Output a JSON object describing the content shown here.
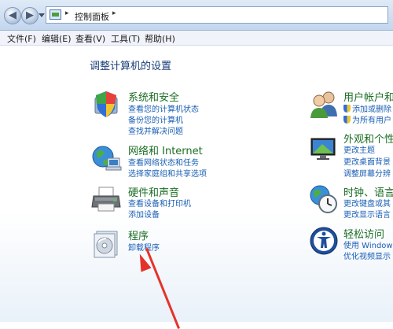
{
  "address": {
    "breadcrumb": "控制面板",
    "separator": "▸"
  },
  "menu": {
    "items": [
      "文件(F)",
      "编辑(E)",
      "查看(V)",
      "工具(T)",
      "帮助(H)"
    ]
  },
  "main": {
    "title": "调整计算机的设置",
    "left_categories": [
      {
        "title": "系统和安全",
        "icon": "security-shield-icon",
        "links": [
          "查看您的计算机状态",
          "备份您的计算机",
          "查找并解决问题"
        ]
      },
      {
        "title": "网络和 Internet",
        "icon": "network-globe-icon",
        "links": [
          "查看网络状态和任务",
          "选择家庭组和共享选项"
        ]
      },
      {
        "title": "硬件和声音",
        "icon": "printer-icon",
        "links": [
          "查看设备和打印机",
          "添加设备"
        ]
      },
      {
        "title": "程序",
        "icon": "programs-disc-icon",
        "links": [
          "卸载程序"
        ]
      }
    ],
    "right_categories": [
      {
        "title": "用户帐户和",
        "icon": "users-icon",
        "links": [
          "添加或删除",
          "为所有用户"
        ]
      },
      {
        "title": "外观和个性",
        "icon": "appearance-monitor-icon",
        "links": [
          "更改主题",
          "更改桌面背景",
          "调整屏幕分辨"
        ]
      },
      {
        "title": "时钟、语言",
        "icon": "clock-globe-icon",
        "links": [
          "更改键盘或其",
          "更改显示语言"
        ]
      },
      {
        "title": "轻松访问",
        "icon": "ease-of-access-icon",
        "links": [
          "使用 Windows",
          "优化视频显示"
        ]
      }
    ]
  },
  "colors": {
    "category_title": "#1b6d23",
    "link": "#1a5fb4",
    "heading": "#1b3d7a",
    "annotation_arrow": "#e5332a"
  }
}
